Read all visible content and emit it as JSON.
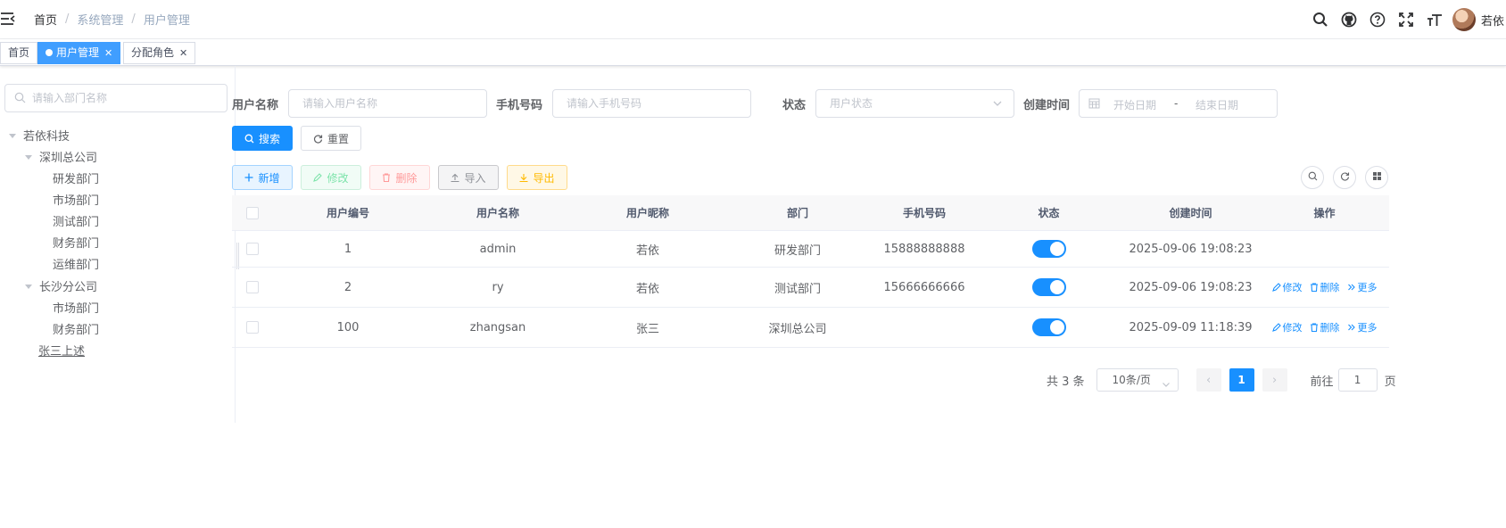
{
  "navbar": {
    "breadcrumb": [
      "首页",
      "系统管理",
      "用户管理"
    ],
    "username": "若依"
  },
  "tags": [
    {
      "label": "首页"
    },
    {
      "label": "用户管理"
    },
    {
      "label": "分配角色"
    }
  ],
  "tree": {
    "search_placeholder": "请输入部门名称",
    "nodes": [
      "若依科技",
      "深圳总公司",
      "研发部门",
      "市场部门",
      "测试部门",
      "财务部门",
      "运维部门",
      "长沙分公司",
      "市场部门",
      "财务部门",
      "张三上述"
    ]
  },
  "search_form": {
    "username_label": "用户名称",
    "username_placeholder": "请输入用户名称",
    "phone_label": "手机号码",
    "phone_placeholder": "请输入手机号码",
    "status_label": "状态",
    "status_placeholder": "用户状态",
    "time_label": "创建时间",
    "start_placeholder": "开始日期",
    "range_sep": "-",
    "end_placeholder": "结束日期",
    "search_btn": "搜索",
    "reset_btn": "重置"
  },
  "toolbar": {
    "add": "新增",
    "edit": "修改",
    "delete": "删除",
    "import": "导入",
    "export": "导出"
  },
  "table": {
    "headers": [
      "用户编号",
      "用户名称",
      "用户昵称",
      "部门",
      "手机号码",
      "状态",
      "创建时间",
      "操作"
    ],
    "rows": [
      {
        "id": "1",
        "username": "admin",
        "nickname": "若依",
        "dept": "研发部门",
        "phone": "15888888888",
        "status": true,
        "created": "2025-09-06 19:08:23",
        "ops": false
      },
      {
        "id": "2",
        "username": "ry",
        "nickname": "若依",
        "dept": "测试部门",
        "phone": "15666666666",
        "status": true,
        "created": "2025-09-06 19:08:23",
        "ops": true
      },
      {
        "id": "100",
        "username": "zhangsan",
        "nickname": "张三",
        "dept": "深圳总公司",
        "phone": "",
        "status": true,
        "created": "2025-09-09 11:18:39",
        "ops": true
      }
    ],
    "op_edit": "修改",
    "op_delete": "删除",
    "op_more": "更多"
  },
  "pagination": {
    "total": "共 3 条",
    "page_size": "10条/页",
    "current": "1",
    "goto_label": "前往",
    "goto_value": "1",
    "page_suffix": "页"
  },
  "colors": {
    "primary": "#1890ff",
    "tag_active": "#409eff"
  }
}
